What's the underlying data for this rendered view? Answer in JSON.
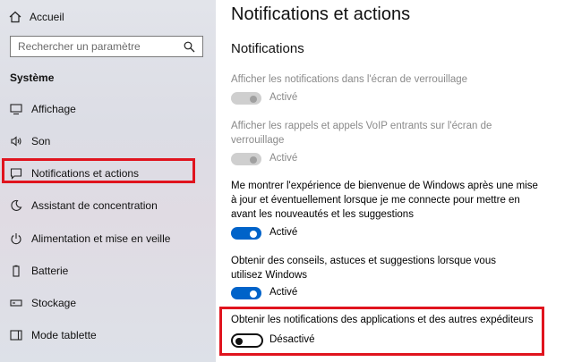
{
  "sidebar": {
    "home_label": "Accueil",
    "search_placeholder": "Rechercher un paramètre",
    "section_label": "Système",
    "items": [
      {
        "label": "Affichage",
        "icon": "display-icon"
      },
      {
        "label": "Son",
        "icon": "speaker-icon"
      },
      {
        "label": "Notifications et actions",
        "icon": "notification-icon",
        "selected": true
      },
      {
        "label": "Assistant de concentration",
        "icon": "moon-icon"
      },
      {
        "label": "Alimentation et mise en veille",
        "icon": "power-icon"
      },
      {
        "label": "Batterie",
        "icon": "battery-icon"
      },
      {
        "label": "Stockage",
        "icon": "storage-icon"
      },
      {
        "label": "Mode tablette",
        "icon": "tablet-icon"
      }
    ]
  },
  "main": {
    "title": "Notifications et actions",
    "subtitle": "Notifications",
    "options": [
      {
        "text": "Afficher les notifications dans l'écran de verrouillage",
        "state": "Activé",
        "enabled": false,
        "on": true
      },
      {
        "text": "Afficher les rappels et appels VoIP entrants sur l'écran de verrouillage",
        "state": "Activé",
        "enabled": false,
        "on": true
      },
      {
        "text": "Me montrer l'expérience de bienvenue de Windows après une mise à jour et éventuellement lorsque je me connecte pour mettre en avant les nouveautés et les suggestions",
        "state": "Activé",
        "enabled": true,
        "on": true
      },
      {
        "text": "Obtenir des conseils, astuces et suggestions lorsque vous utilisez Windows",
        "state": "Activé",
        "enabled": true,
        "on": true
      },
      {
        "text": "Obtenir les notifications des applications et des autres expéditeurs",
        "state": "Désactivé",
        "enabled": true,
        "on": false
      }
    ]
  },
  "colors": {
    "accent": "#0063c9",
    "highlight": "#e0141e"
  }
}
